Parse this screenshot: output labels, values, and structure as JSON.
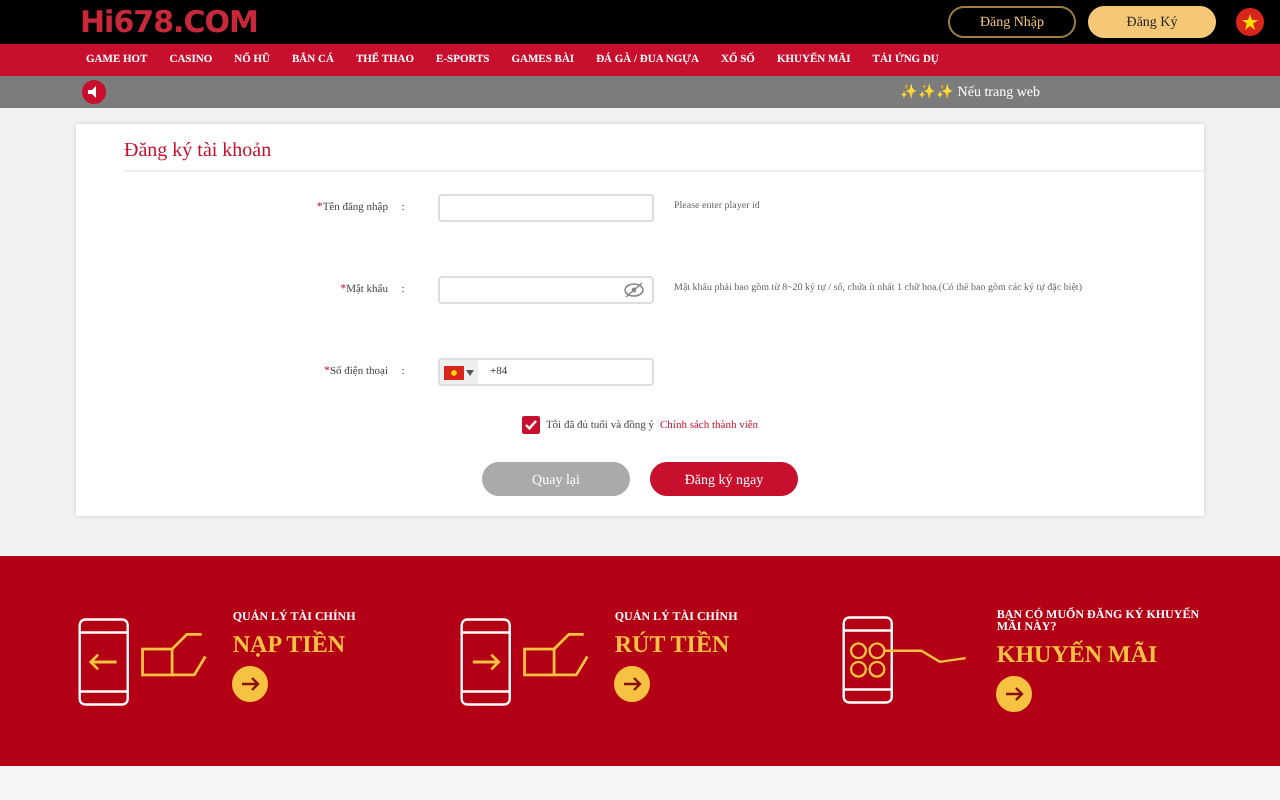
{
  "header": {
    "logo": "Hi678.COM",
    "buttons": [
      {
        "label": "Đăng Nhập",
        "kind": "outline"
      },
      {
        "label": "Đăng Ký",
        "kind": "filled"
      }
    ]
  },
  "nav": [
    "GAME HOT",
    "CASINO",
    "NỔ HŨ",
    "BẮN CÁ",
    "THỂ THAO",
    "E-SPORTS",
    "GAMES BÀI",
    "ĐÁ GÀ / ĐUA NGỰA",
    "XỔ SỐ",
    "KHUYẾN MÃI",
    "TẢI ỨNG DỤ"
  ],
  "marquee": {
    "sparkles": "✨✨✨",
    "text": "Nếu trang web"
  },
  "form": {
    "title": "Đăng ký tài khoản",
    "fields": [
      {
        "mark": "*",
        "label": "Tên đăng nhập",
        "colon": ":",
        "kind": "text",
        "hint": "Please enter player id"
      },
      {
        "mark": "*",
        "label": "Mật khẩu",
        "colon": ":",
        "kind": "password",
        "hint": "Mật khẩu phải bao gồm từ 8~20 ký tự / số, chứa ít nhất 1 chữ hoa.(Có thể bao gồm các ký tự đặc biệt)"
      },
      {
        "mark": "*",
        "label": "Số điện thoại",
        "colon": ":",
        "kind": "phone",
        "value": "+84"
      }
    ],
    "agree": {
      "checked": true,
      "text": "Tôi đã đủ tuổi và đồng ý",
      "link": "Chính sách thành viên"
    },
    "buttons": [
      {
        "label": "Quay lại",
        "kind": "back"
      },
      {
        "label": "Đăng ký ngay",
        "kind": "submit"
      }
    ]
  },
  "promos": [
    {
      "kind": "deposit",
      "subtitle": "QUẢN LÝ TÀI CHÍNH",
      "title": "NẠP TIỀN"
    },
    {
      "kind": "withdraw",
      "subtitle": "QUẢN LÝ TÀI CHÍNH",
      "title": "RÚT TIỀN"
    },
    {
      "kind": "promo",
      "subtitle": "BẠN CÓ MUỐN ĐĂNG KÝ KHUYẾN MÃI NÀY?",
      "title": "KHUYẾN MÃI"
    }
  ]
}
